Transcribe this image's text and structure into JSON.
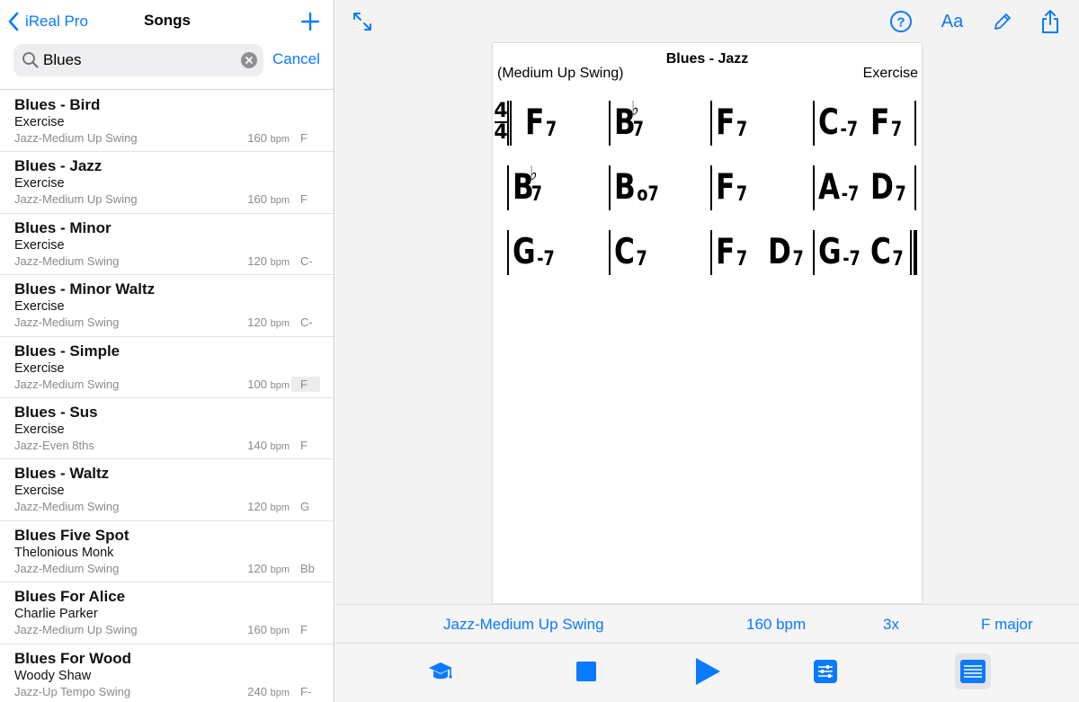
{
  "colors": {
    "accent": "#0a7aff",
    "secondary_text": "#8a8a8e"
  },
  "nav": {
    "back_label": "iReal Pro",
    "title": "Songs",
    "add_icon": "plus-icon"
  },
  "search": {
    "value": "Blues",
    "cancel_label": "Cancel"
  },
  "songs": [
    {
      "title": "Blues - Bird",
      "composer": "Exercise",
      "style": "Jazz-Medium Up Swing",
      "bpm": "160",
      "bpm_unit": "bpm",
      "key": "F"
    },
    {
      "title": "Blues - Jazz",
      "composer": "Exercise",
      "style": "Jazz-Medium Up Swing",
      "bpm": "160",
      "bpm_unit": "bpm",
      "key": "F"
    },
    {
      "title": "Blues - Minor",
      "composer": "Exercise",
      "style": "Jazz-Medium Swing",
      "bpm": "120",
      "bpm_unit": "bpm",
      "key": "C-"
    },
    {
      "title": "Blues - Minor Waltz",
      "composer": "Exercise",
      "style": "Jazz-Medium Swing",
      "bpm": "120",
      "bpm_unit": "bpm",
      "key": "C-"
    },
    {
      "title": "Blues - Simple",
      "composer": "Exercise",
      "style": "Jazz-Medium Swing",
      "bpm": "100",
      "bpm_unit": "bpm",
      "key": "F"
    },
    {
      "title": "Blues - Sus",
      "composer": "Exercise",
      "style": "Jazz-Even 8ths",
      "bpm": "140",
      "bpm_unit": "bpm",
      "key": "F"
    },
    {
      "title": "Blues - Waltz",
      "composer": "Exercise",
      "style": "Jazz-Medium Swing",
      "bpm": "120",
      "bpm_unit": "bpm",
      "key": "G"
    },
    {
      "title": "Blues Five Spot",
      "composer": "Thelonious Monk",
      "style": "Jazz-Medium Swing",
      "bpm": "120",
      "bpm_unit": "bpm",
      "key": "Bb"
    },
    {
      "title": "Blues For Alice",
      "composer": "Charlie Parker",
      "style": "Jazz-Medium Up Swing",
      "bpm": "160",
      "bpm_unit": "bpm",
      "key": "F"
    },
    {
      "title": "Blues For Wood",
      "composer": "Woody Shaw",
      "style": "Jazz-Up Tempo Swing",
      "bpm": "240",
      "bpm_unit": "bpm",
      "key": "F-"
    }
  ],
  "toolbar": {
    "expand_icon": "expand-icon",
    "help_icon": "help-icon",
    "font_label": "Aa",
    "edit_icon": "pencil-icon",
    "share_icon": "share-icon"
  },
  "sheet": {
    "title": "Blues - Jazz",
    "style": "(Medium Up Swing)",
    "composer": "Exercise",
    "time_signature": [
      "4",
      "4"
    ],
    "rows": [
      [
        [
          [
            "F",
            "7"
          ]
        ],
        [
          [
            "B",
            "7",
            "b"
          ]
        ],
        [
          [
            "F",
            "7"
          ]
        ],
        [
          [
            "C",
            "-7"
          ],
          [
            "F",
            "7"
          ]
        ]
      ],
      [
        [
          [
            "B",
            "7",
            "b"
          ]
        ],
        [
          [
            "B",
            "o7"
          ]
        ],
        [
          [
            "F",
            "7"
          ]
        ],
        [
          [
            "A",
            "-7"
          ],
          [
            "D",
            "7"
          ]
        ]
      ],
      [
        [
          [
            "G",
            "-7"
          ]
        ],
        [
          [
            "C",
            "7"
          ]
        ],
        [
          [
            "F",
            "7"
          ],
          [
            "D",
            "7"
          ]
        ],
        [
          [
            "G",
            "-7"
          ],
          [
            "C",
            "7"
          ]
        ]
      ]
    ]
  },
  "info": {
    "style": "Jazz-Medium Up Swing",
    "tempo": "160 bpm",
    "repeats": "3x",
    "key": "F major"
  },
  "bottom": {
    "icons": [
      "graduation-cap-icon",
      "stop-icon",
      "play-icon",
      "mixer-icon",
      "chord-list-icon"
    ]
  }
}
